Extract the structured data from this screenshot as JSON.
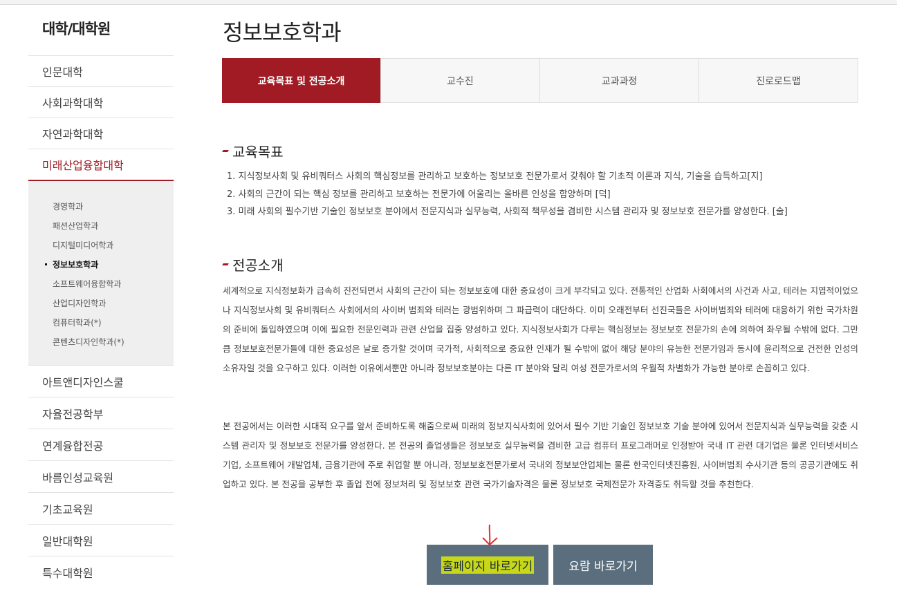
{
  "sidebar": {
    "title": "대학/대학원",
    "items_before": [
      "인문대학",
      "사회과학대학",
      "자연과학대학"
    ],
    "active": "미래산업융합대학",
    "sub_items": [
      "경영학과",
      "패션산업학과",
      "디지털미디어학과",
      "정보보호학과",
      "소프트웨어융합학과",
      "산업디자인학과",
      "컴퓨터학과(*)",
      "콘텐츠디자인학과(*)"
    ],
    "items_after": [
      "아트앤디자인스쿨",
      "자율전공학부",
      "연계융합전공",
      "바름인성교육원",
      "기초교육원",
      "일반대학원",
      "특수대학원"
    ]
  },
  "main": {
    "title": "정보보호학과",
    "tabs": [
      "교육목표 및 전공소개",
      "교수진",
      "교과과정",
      "진로로드맵"
    ],
    "goals_heading": "교육목표",
    "goals": [
      "1. 지식정보사회 및 유비쿼터스 사회의 핵심정보를 관리하고 보호하는 정보보호 전문가로서 갖춰야 할 기초적 이론과 지식, 기술을 습득하고[지]",
      "2. 사회의 근간이 되는 핵심 정보를 관리하고 보호하는 전문가에 어울리는 올바른 인성을 함양하며 [덕]",
      "3. 미래 사회의 필수기반 기술인 정보보호 분야에서 전문지식과 실무능력, 사회적 책무성을 겸비한 시스템 관리자 및 정보보호 전문가를 양성한다. [술]"
    ],
    "intro_heading": "전공소개",
    "intro_p1": "세계적으로 지식정보화가 급속히 진전되면서 사회의 근간이 되는 정보보호에 대한 중요성이 크게 부각되고 있다. 전통적인 산업화 사회에서의 사건과 사고, 테러는 지엽적이었으나 지식정보사회 및 유비쿼터스 사회에서의 사이버 범죄와 테러는 광범위하며 그 파급력이 대단하다. 이미 오래전부터 선진국들은 사이버범죄와 테러에 대응하기 위한 국가차원의 준비에 돌입하였으며 이에 필요한 전문인력과 관련 산업을 집중 양성하고 있다. 지식정보사회가 다루는 핵심정보는 정보보호 전문가의 손에 의하여 좌우될 수밖에 없다. 그만큼 정보보호전문가들에 대한 중요성은 날로 증가할 것이며 국가적, 사회적으로 중요한 인재가 될 수밖에 없어 해당 분야의 유능한 전문가임과 동시에 윤리적으로 건전한 인성의 소유자일 것을 요구하고 있다. 이러한 이유에서뿐만 아니라 정보보호분야는 다른 IT 분야와 달리 여성 전문가로서의 우월적 차별화가 가능한 분야로 손꼽히고 있다.",
    "intro_p2": "본 전공에서는 이러한 시대적 요구를 앞서 준비하도록 해줌으로써 미래의 정보지식사회에 있어서 필수 기반 기술인 정보보호 기술 분야에 있어서 전문지식과 실무능력을 갖춘 시스템 관리자 및 정보보호 전문가를 양성한다. 본 전공의 졸업생들은 정보보호 실무능력을 겸비한 고급 컴퓨터 프로그래머로 인정받아 국내 IT 관련 대기업은 물론 인터넷서비스 기업, 소프트웨어 개발업체, 금융기관에 주로 취업할 뿐 아니라, 정보보호전문가로서 국내외 정보보안업체는 물론 한국인터넷진흥원, 사이버범죄 수사기관 등의 공공기관에도 취업하고 있다. 본 전공을 공부한 후 졸업 전에 정보처리 및 정보보호 관련 국가기술자격은 물론 정보보호 국제전문가 자격증도 취득할 것을 추천한다.",
    "buttons": {
      "homepage": "홈페이지 바로가기",
      "summary": "요람 바로가기"
    }
  },
  "colors": {
    "accent": "#a01b23",
    "button": "#5b6e7d",
    "highlight": "#c8d818"
  }
}
